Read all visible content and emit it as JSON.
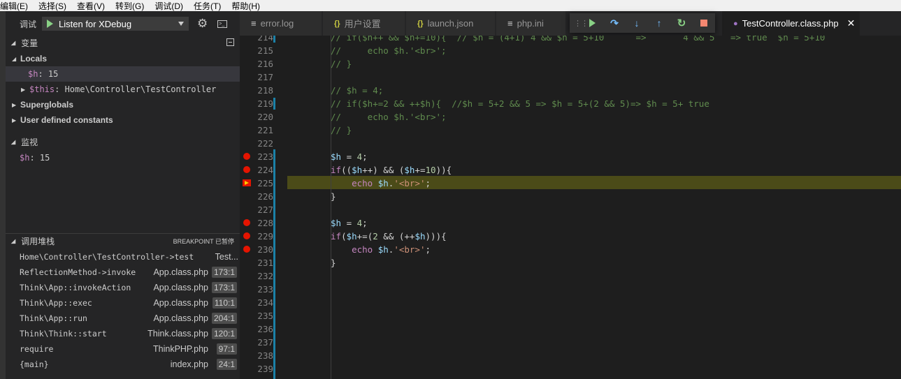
{
  "menu": [
    "编辑(E)",
    "选择(S)",
    "查看(V)",
    "转到(G)",
    "调试(D)",
    "任务(T)",
    "帮助(H)"
  ],
  "debug_toolbar": {
    "title": "调试",
    "config": "Listen for XDebug"
  },
  "variables": {
    "title": "变量",
    "locals_label": "Locals",
    "locals": [
      {
        "name": "$h",
        "value": "15"
      },
      {
        "name": "$this",
        "value": "Home\\Controller\\TestController"
      }
    ],
    "superglobals_label": "Superglobals",
    "constants_label": "User defined constants"
  },
  "watch": {
    "title": "监视",
    "items": [
      {
        "name": "$h",
        "value": "15"
      }
    ]
  },
  "call_stack": {
    "title": "调用堆栈",
    "status": "BREAKPOINT 已暂停",
    "frames": [
      {
        "name": "Home\\Controller\\TestController->test",
        "file": "Test...",
        "line": ""
      },
      {
        "name": "ReflectionMethod->invoke",
        "file": "App.class.php",
        "line": "173:1"
      },
      {
        "name": "Think\\App::invokeAction",
        "file": "App.class.php",
        "line": "173:1"
      },
      {
        "name": "Think\\App::exec",
        "file": "App.class.php",
        "line": "110:1"
      },
      {
        "name": "Think\\App::run",
        "file": "App.class.php",
        "line": "204:1"
      },
      {
        "name": "Think\\Think::start",
        "file": "Think.class.php",
        "line": "120:1"
      },
      {
        "name": "require",
        "file": "ThinkPHP.php",
        "line": "97:1"
      },
      {
        "name": "{main}",
        "file": "index.php",
        "line": "24:1"
      }
    ]
  },
  "tabs": [
    {
      "label": "error.log",
      "icon": "lines"
    },
    {
      "label": "用户设置",
      "icon": "braces"
    },
    {
      "label": "launch.json",
      "icon": "braces"
    },
    {
      "label": "php.ini",
      "icon": "lines"
    },
    {
      "label": "TestController.class.php",
      "icon": "php",
      "active": true
    }
  ],
  "editor": {
    "line_numbers": [
      "214",
      "215",
      "216",
      "217",
      "218",
      "219",
      "220",
      "221",
      "222",
      "223",
      "224",
      "225",
      "226",
      "227",
      "228",
      "229",
      "230",
      "231",
      "232",
      "233",
      "234",
      "235",
      "236",
      "237",
      "238",
      "239"
    ],
    "breakpoints": [
      "223",
      "224",
      "228",
      "229",
      "230"
    ],
    "current_line": "225",
    "lines": {
      "l214": "// if($h++ && $h+=10){  // $h = (4+1) 4 && $h = 5+10      =>       4 && 5   => true  $h = 5+10",
      "l215": "//     echo $h.'<br>';",
      "l216": "// }",
      "l218": "// $h = 4;",
      "l219": "// if($h+=2 && ++$h){  //$h = 5+2 && 5 => $h = 5+(2 && 5)=> $h = 5+ true",
      "l220": "//     echo $h.'<br>';",
      "l221": "// }",
      "l223a": "$h",
      "l223b": " = ",
      "l223c": "4",
      "l223d": ";",
      "l224a": "if",
      "l224b": "((",
      "l224c": "$h",
      "l224d": "++) && (",
      "l224e": "$h",
      "l224f": "+=",
      "l224g": "10",
      "l224h": ")){",
      "l225a": "    echo ",
      "l225b": "$h",
      "l225c": ".",
      "l225d": "'<br>'",
      "l225e": ";",
      "l226": "}",
      "l228a": "$h",
      "l228b": " = ",
      "l228c": "4",
      "l228d": ";",
      "l229a": "if",
      "l229b": "(",
      "l229c": "$h",
      "l229d": "+=(",
      "l229e": "2",
      "l229f": " && (++",
      "l229g": "$h",
      "l229h": "))){",
      "l230a": "    echo ",
      "l230b": "$h",
      "l230c": ".",
      "l230d": "'<br>'",
      "l230e": ";",
      "l231": "}"
    }
  }
}
